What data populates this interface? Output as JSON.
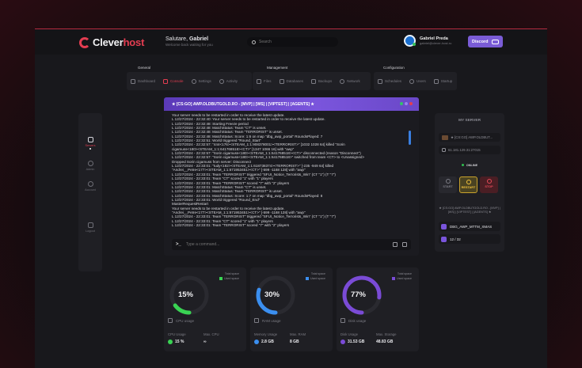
{
  "header": {
    "logo_part1": "Clever",
    "logo_part2": "host",
    "greeting": "Salutare,",
    "user_first": "Gabriel",
    "greeting_sub": "Welcome back waiting for you",
    "search_placeholder": "Search",
    "user_name": "Gabriel Preda",
    "user_email": "gabriel@clever-host.ro",
    "discord_label": "Discord"
  },
  "nav": {
    "general_title": "General",
    "general_items": [
      "Dashboard",
      "Console",
      "Settings",
      "Activity"
    ],
    "management_title": "Management",
    "management_items": [
      "Files",
      "Databases",
      "Backups",
      "Network"
    ],
    "configuration_title": "Configuration",
    "configuration_items": [
      "Schedules",
      "Users",
      "Startup"
    ],
    "active": "Console"
  },
  "sidebar": {
    "items": [
      "Servers",
      "Admin",
      "Account"
    ],
    "logout": "Logout"
  },
  "console": {
    "title": "★ [CS:GO] AWP.OLDBUTGOLD.RO - [MVP] | [WS] | [VIPTEST] | [AGENTS] ★",
    "input_placeholder": "Type a command...",
    "lines": [
      "Your server needs to be restarted in order to receive the latest update.",
      "L 12/27/2024 - 22:32:40: Your server needs to be restarted in order to receive the latest update.",
      "L 12/27/2024 - 22:32:48: Starting Freeze period",
      "L 12/27/2024 - 22:32:48: MatchStatus: Team \"CT\" is unset.",
      "L 12/27/2024 - 22:32:48: MatchStatus: Team \"TERRORIST\" is unset.",
      "L 12/27/2024 - 22:32:48: MatchStatus: Score: 1:6 on map \"dbg_awp_portal\" RoundsPlayed: 7",
      "L 12/27/2024 - 22:32:51: World triggered \"Round_Start\"",
      "L 12/27/2024 - 22:32:57: \"444<176><STEAM_1:1:908378001><TERRORIST>\" [1032 1028 64] killed \"Sorin",
      "cigamuss<180><STEAM_1:1:641768518><CT>\" [1347 1066 16] with \"awp\"",
      "L 12/27/2024 - 22:32:57: \"Sorin cigamuss<180><STEAM_1:1:641768518><CT>\" disconnected (reason \"Disconnect\")",
      "L 12/27/2024 - 22:32:57: \"Sorin cigamuss<180><STEAM_1:1:641768518>\" switched from team <CT> to <Unassigned>",
      "Dropped Sorin cigamuss from server: Disconnect",
      "L 12/27/2024 - 22:33:01: \"tudy<182><STEAM_1:1:618738374><TERRORIST>\" [-235 -949 64] killed",
      "\"Andrei__Petre<177><STEAM_1:1:671953451><CT>\" [-599 -1168 128] with \"awp\"",
      "L 12/27/2024 - 22:33:01: Team \"TERRORIST\" triggered \"SFUI_Notice_Terrorists_Win\" (CT \"1\") (T \"7\")",
      "L 12/27/2024 - 22:33:01: Team \"CT\" scored \"1\" with \"1\" players",
      "L 12/27/2024 - 22:33:01: Team \"TERRORIST\" scored \"7\" with \"2\" players",
      "L 12/27/2024 - 22:33:01: MatchStatus: Team \"CT\" is unset.",
      "L 12/27/2024 - 22:33:01: MatchStatus: Team \"TERRORIST\" is unset.",
      "L 12/27/2024 - 22:33:01: MatchStatus: Score: 1:7 on map \"dbg_awp_portal\" RoundsPlayed: 8",
      "L 12/27/2024 - 22:33:01: World triggered \"Round_End\"",
      "MasterRequestRestart",
      "Your server needs to be restarted in order to receive the latest update.",
      "\"Andrei__Petre<177><STEAM_1:1:671953451><CT>\" [-599 -1168 128] with \"awp\"",
      "L 12/27/2024 - 22:33:01: Team \"TERRORIST\" triggered \"SFUI_Notice_Terrorists_Win\" (CT \"1\") (T \"7\")",
      "L 12/27/2024 - 22:33:01: Team \"CT\" scored \"1\" with \"1\" players",
      "L 12/27/2024 - 22:33:01: Team \"TERRORIST\" scored \"7\" with \"2\" players"
    ]
  },
  "server_panel": {
    "title": "MY SERVER",
    "server_name": "★ [CS:GO] AWP.OLDBUT...",
    "ip": "61.181.129.31:27015",
    "status": "ONLINE",
    "btn_start": "START",
    "btn_restart": "RESTART",
    "btn_stop": "STOP",
    "full_name": "★ [CS:GO] AWP.OLDBUTGOLD.RO - [MVP] | [WS] | [VIPTEST] | [AGENTS] ★",
    "map": "DBG_AWP_MTTM_XMAS",
    "players": "12 / 32"
  },
  "gauges": [
    {
      "legend_total": "Total space",
      "legend_used": "Used space",
      "percent": 15,
      "percent_label": "15%",
      "label": "CPU usage",
      "stat1_name": "CPU Usage",
      "stat1_value": "15 %",
      "stat2_name": "Max. CPU",
      "stat2_value": "∞",
      "color": "#39d353"
    },
    {
      "legend_total": "Total space",
      "legend_used": "Used space",
      "percent": 30,
      "percent_label": "30%",
      "label": "RAM usage",
      "stat1_name": "Memory Usage",
      "stat1_value": "2.8 GB",
      "stat2_name": "Max. RAM",
      "stat2_value": "8 GB",
      "color": "#3b8ff0"
    },
    {
      "legend_total": "Total space",
      "legend_used": "Used space",
      "percent": 77,
      "percent_label": "77%",
      "label": "Disk usage",
      "stat1_name": "Disk Usage",
      "stat1_value": "31.53 GB",
      "stat2_name": "Max. Storage",
      "stat2_value": "48.83 GB",
      "color": "#7a4bd6"
    }
  ]
}
